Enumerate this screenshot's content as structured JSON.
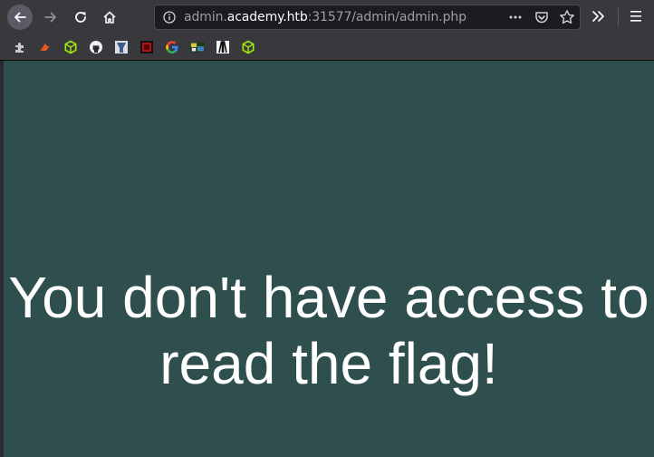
{
  "browser": {
    "url": {
      "prefix": "admin.",
      "domain": "academy.htb",
      "suffix": ":31577/admin/admin.php"
    },
    "nav_icons": [
      "back-arrow-icon",
      "forward-arrow-icon",
      "reload-icon",
      "home-icon"
    ],
    "url_icons": [
      "info-icon",
      "page-actions-icon",
      "pocket-icon",
      "bookmark-star-icon"
    ],
    "right_icons": [
      "overflow-chevrons-icon",
      "hamburger-menu-icon"
    ],
    "bookmarks": [
      {
        "icon": "extensions-puzzle-icon"
      },
      {
        "icon": "burp-icon"
      },
      {
        "icon": "hackthebox-cube-icon"
      },
      {
        "icon": "github-icon"
      },
      {
        "icon": "bookmark-site-icon"
      },
      {
        "icon": "bookmark-red-icon"
      },
      {
        "icon": "google-icon"
      },
      {
        "icon": "bookmark-image-icon"
      },
      {
        "icon": "bookmark-tower-icon"
      },
      {
        "icon": "hackthebox-cube-icon"
      }
    ]
  },
  "page": {
    "message": "You don't have access to read the flag!",
    "background_color": "#2f4f4f",
    "text_color": "#ffffff"
  }
}
